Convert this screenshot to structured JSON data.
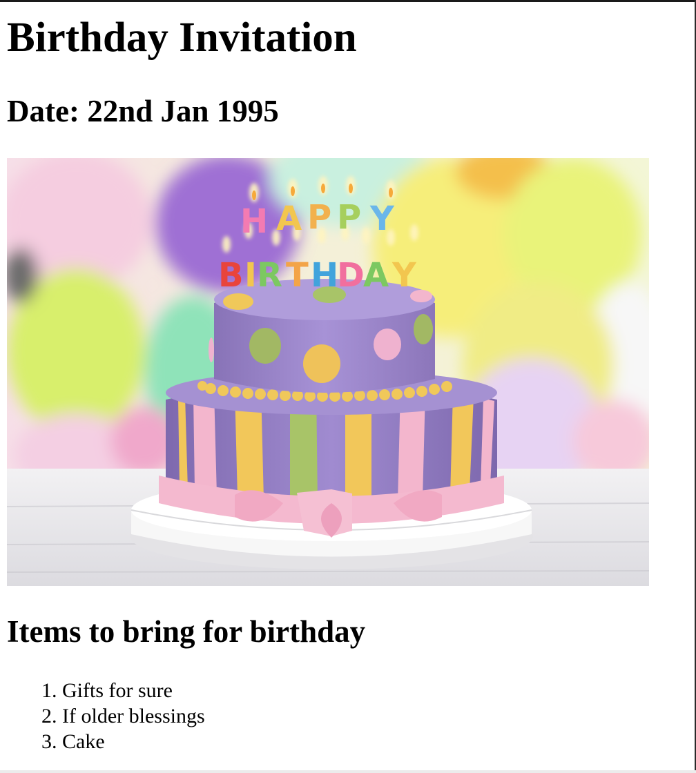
{
  "page": {
    "title": "Birthday Invitation",
    "date_line": "Date: 22nd Jan 1995",
    "image": {
      "depicts": "cake-image",
      "candle_letters_top": "HAPPY",
      "candle_letters_bottom": "BIRTHDAY"
    },
    "items_heading": "Items to bring for birthday",
    "items": [
      "Gifts for sure",
      "If older blessings",
      "Cake"
    ]
  },
  "colors": {
    "background": "#ffffff",
    "text": "#000000",
    "cake_purple": "#9a83c8",
    "cake_pink": "#f4b9cf",
    "cake_yellow": "#f2c75a",
    "cake_green": "#a8c468"
  }
}
